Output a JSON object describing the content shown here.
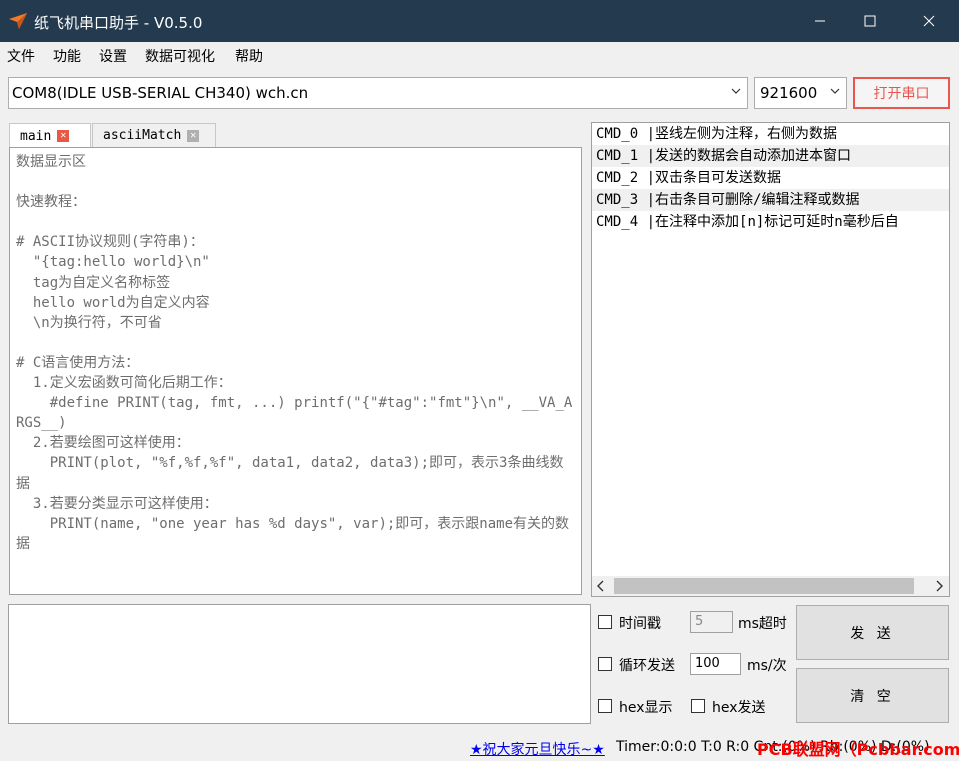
{
  "window": {
    "title": "纸飞机串口助手 - V0.5.0",
    "minimize_icon": "minimize-icon",
    "maximize_icon": "maximize-icon",
    "close_icon": "close-icon",
    "title_bar_color": "#243a4f"
  },
  "menu": {
    "items": [
      {
        "label": "文件"
      },
      {
        "label": "功能"
      },
      {
        "label": "设置"
      },
      {
        "label": "数据可视化"
      },
      {
        "label": "帮助"
      }
    ]
  },
  "port": {
    "selected": "COM8(IDLE  USB-SERIAL CH340) wch.cn",
    "baud": "921600",
    "open_button": "打开串口",
    "accent": "#e8564f"
  },
  "tabs": [
    {
      "label": "main",
      "active": true
    },
    {
      "label": "asciiMatch",
      "active": false
    }
  ],
  "display": {
    "text": "数据显示区\n\n快速教程：\n\n# ASCII协议规则(字符串)：\n  \"{tag:hello world}\\n\"\n  tag为自定义名称标签\n  hello world为自定义内容\n  \\n为换行符，不可省\n\n# C语言使用方法：\n  1.定义宏函数可简化后期工作：\n    #define PRINT(tag, fmt, ...) printf(\"{\"#tag\":\"fmt\"}\\n\", __VA_ARGS__)\n  2.若要绘图可这样使用：\n    PRINT(plot, \"%f,%f,%f\", data1, data2, data3);即可，表示3条曲线数据\n  3.若要分类显示可这样使用：\n    PRINT(name, \"one year has %d days\", var);即可，表示跟name有关的数据"
  },
  "commands": [
    {
      "name": "CMD_0",
      "text": "|竖线左侧为注释，右侧为数据"
    },
    {
      "name": "CMD_1",
      "text": "|发送的数据会自动添加进本窗口"
    },
    {
      "name": "CMD_2",
      "text": "|双击条目可发送数据"
    },
    {
      "name": "CMD_3",
      "text": "|右击条目可删除/编辑注释或数据"
    },
    {
      "name": "CMD_4",
      "text": "|在注释中添加[n]标记可延时n毫秒后自"
    }
  ],
  "send": {
    "timestamp_label": "时间戳",
    "timeout_value": "5",
    "timeout_unit": "ms超时",
    "loop_label": "循环发送",
    "loop_value": "100",
    "loop_unit": "ms/次",
    "hex_display_label": "hex显示",
    "hex_send_label": "hex发送",
    "send_button": "发 送",
    "clear_button": "清 空"
  },
  "status": {
    "link": "★祝大家元旦快乐~★",
    "text": "Timer:0:0:0 T:0 R:0 Cnt:(0%) Rb:(0%) D:(0%)",
    "watermark": "PCB联盟网（Pcbbar.com）"
  }
}
